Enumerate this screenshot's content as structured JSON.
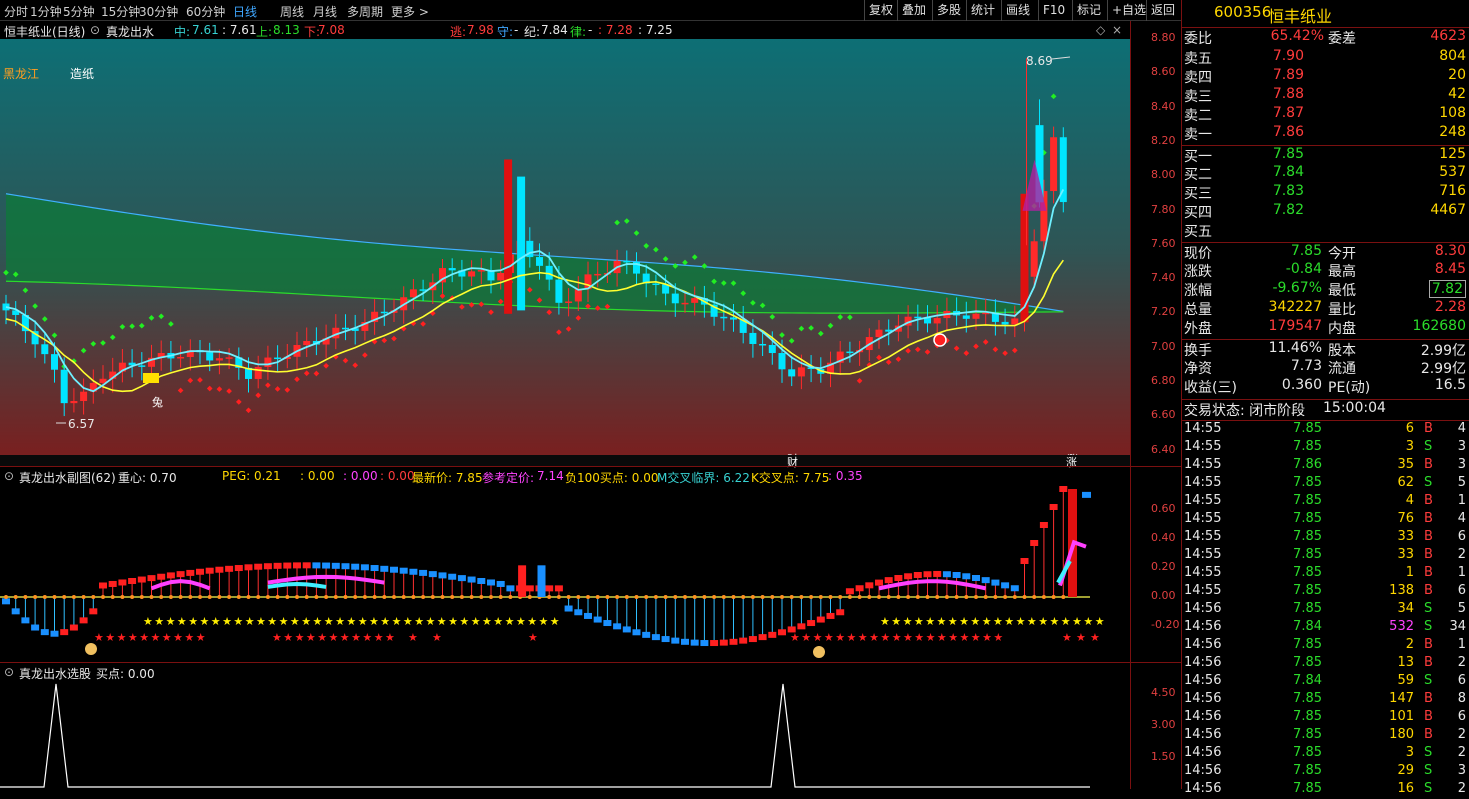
{
  "toolbar": {
    "periods": [
      "分时",
      "1分钟",
      "5分钟",
      "15分钟",
      "30分钟",
      "60分钟",
      "日线",
      "周线",
      "月线",
      "多周期",
      "更多"
    ],
    "active_period": "日线",
    "right_buttons": [
      "复权",
      "叠加",
      "多股",
      "统计",
      "画线",
      "F10",
      "标记",
      "+自选",
      "返回"
    ]
  },
  "main_chart": {
    "stock_label": "恒丰纸业(日线)",
    "indicator": "真龙出水",
    "zhong_label": "中:",
    "zhong_value": "7.61",
    "mid2_value": ": 7.61",
    "shang_label": "上:",
    "shang_value": "8.13",
    "xia_label": "下:",
    "xia_value": "7.08",
    "tao_label": "逃:",
    "tao_value": "7.98",
    "shou_label": "守:",
    "shou_value": "-",
    "ji_label": "纪:",
    "ji_value": "7.84",
    "lv_label": "律:",
    "lv_value": "-",
    "v728": ": 7.28",
    "v725": ": 7.25",
    "region": "黑龙江",
    "industry": "造纸",
    "high_label": "8.69",
    "low_label": "6.57",
    "marker_cai": "财",
    "marker_zhang": "涨",
    "marker_tu": "兔",
    "y_ticks": [
      "8.80",
      "8.60",
      "8.40",
      "8.20",
      "8.00",
      "7.80",
      "7.60",
      "7.40",
      "7.20",
      "7.00",
      "6.80",
      "6.60",
      "6.40"
    ]
  },
  "sub_chart": {
    "title": "真龙出水副图(62)",
    "zhongxin": "重心: 0.70",
    "peg": "PEG: 0.21",
    "v0a": ": 0.00",
    "v0b": ": 0.00",
    "v0c": ": 0.00",
    "latest": "最新价: 7.85",
    "ref_label": "参考定价:",
    "ref_value": "7.14",
    "buy100": "负100买点: 0.00",
    "mcross": "M交叉临界: 6.22",
    "kcross": "K交叉点: 7.75",
    "v035": ": 0.35",
    "y_ticks": [
      "0.60",
      "0.40",
      "0.20",
      "0.00",
      "-0.20"
    ]
  },
  "select_chart": {
    "title": "真龙出水选股",
    "buy": "买点: 0.00",
    "y_ticks": [
      "4.50",
      "3.00",
      "1.50"
    ]
  },
  "quote": {
    "code": "600356",
    "name": "恒丰纸业",
    "weibi_label": "委比",
    "weibi": "65.42%",
    "weicha_label": "委差",
    "weicha": "4623",
    "asks": [
      {
        "label": "卖五",
        "price": "7.90",
        "vol": "804"
      },
      {
        "label": "卖四",
        "price": "7.89",
        "vol": "20"
      },
      {
        "label": "卖三",
        "price": "7.88",
        "vol": "42"
      },
      {
        "label": "卖二",
        "price": "7.87",
        "vol": "108"
      },
      {
        "label": "卖一",
        "price": "7.86",
        "vol": "248"
      }
    ],
    "bids": [
      {
        "label": "买一",
        "price": "7.85",
        "vol": "125"
      },
      {
        "label": "买二",
        "price": "7.84",
        "vol": "537"
      },
      {
        "label": "买三",
        "price": "7.83",
        "vol": "716"
      },
      {
        "label": "买四",
        "price": "7.82",
        "vol": "4467"
      },
      {
        "label": "买五",
        "price": "",
        "vol": ""
      }
    ],
    "stats": [
      {
        "l1": "现价",
        "v1": "7.85",
        "c1": "grn",
        "l2": "今开",
        "v2": "8.30",
        "c2": "red"
      },
      {
        "l1": "涨跌",
        "v1": "-0.84",
        "c1": "grn",
        "l2": "最高",
        "v2": "8.45",
        "c2": "red"
      },
      {
        "l1": "涨幅",
        "v1": "-9.67%",
        "c1": "grn",
        "l2": "最低",
        "v2": "7.82",
        "c2": "grn"
      },
      {
        "l1": "总量",
        "v1": "342227",
        "c1": "yel",
        "l2": "量比",
        "v2": "2.28",
        "c2": "red"
      },
      {
        "l1": "外盘",
        "v1": "179547",
        "c1": "red",
        "l2": "内盘",
        "v2": "162680",
        "c2": "grn"
      }
    ],
    "stats2": [
      {
        "l1": "换手",
        "v1": "11.46%",
        "l2": "股本",
        "v2": "2.99亿"
      },
      {
        "l1": "净资",
        "v1": "7.73",
        "l2": "流通",
        "v2": "2.99亿"
      },
      {
        "l1": "收益(三)",
        "v1": "0.360",
        "l2": "PE(动)",
        "v2": "16.5"
      }
    ],
    "trade_status_label": "交易状态: 闭市阶段",
    "trade_status_time": "15:00:04",
    "ticks": [
      [
        "14:55",
        "7.85",
        "6",
        "B",
        "4"
      ],
      [
        "14:55",
        "7.85",
        "3",
        "S",
        "3"
      ],
      [
        "14:55",
        "7.86",
        "35",
        "B",
        "3"
      ],
      [
        "14:55",
        "7.85",
        "62",
        "S",
        "5"
      ],
      [
        "14:55",
        "7.85",
        "4",
        "B",
        "1"
      ],
      [
        "14:55",
        "7.85",
        "76",
        "B",
        "4"
      ],
      [
        "14:55",
        "7.85",
        "33",
        "B",
        "6"
      ],
      [
        "14:55",
        "7.85",
        "33",
        "B",
        "2"
      ],
      [
        "14:55",
        "7.85",
        "1",
        "B",
        "1"
      ],
      [
        "14:55",
        "7.85",
        "138",
        "B",
        "6"
      ],
      [
        "14:56",
        "7.85",
        "34",
        "S",
        "5"
      ],
      [
        "14:56",
        "7.84",
        "532",
        "S",
        "34"
      ],
      [
        "14:56",
        "7.85",
        "2",
        "B",
        "1"
      ],
      [
        "14:56",
        "7.85",
        "13",
        "B",
        "2"
      ],
      [
        "14:56",
        "7.84",
        "59",
        "S",
        "6"
      ],
      [
        "14:56",
        "7.85",
        "147",
        "B",
        "8"
      ],
      [
        "14:56",
        "7.85",
        "101",
        "B",
        "6"
      ],
      [
        "14:56",
        "7.85",
        "180",
        "B",
        "2"
      ],
      [
        "14:56",
        "7.85",
        "3",
        "S",
        "2"
      ],
      [
        "14:56",
        "7.85",
        "29",
        "S",
        "3"
      ],
      [
        "14:56",
        "7.85",
        "16",
        "S",
        "2"
      ]
    ]
  },
  "colors": {
    "up": "#ff3c3c",
    "down": "#00e0e0",
    "accent": "#3fa7ff",
    "grid": "#7a1010"
  }
}
